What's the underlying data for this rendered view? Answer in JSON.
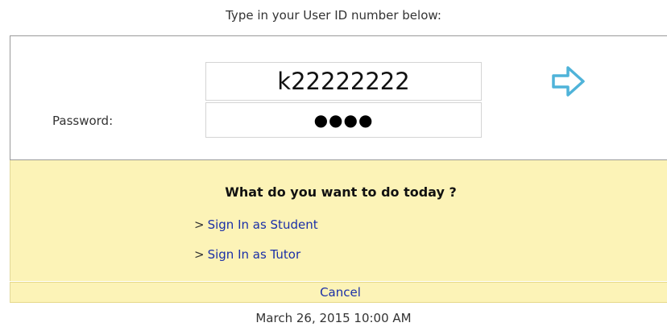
{
  "instructions": "Type in your User ID number below:",
  "login": {
    "user_id_value": "k22222222",
    "password_label": "Password:",
    "password_masked": "●●●●",
    "go_icon": "arrow-right-icon"
  },
  "options": {
    "title": "What do you want to do today ?",
    "items": [
      {
        "prefix": ">",
        "label": "Sign In as Student"
      },
      {
        "prefix": ">",
        "label": "Sign In as Tutor"
      }
    ]
  },
  "cancel_label": "Cancel",
  "timestamp": "March 26, 2015 10:00 AM",
  "colors": {
    "panel_background": "#fcf3b7",
    "link": "#1a2fa8",
    "arrow_icon": "#4fb3d9"
  }
}
